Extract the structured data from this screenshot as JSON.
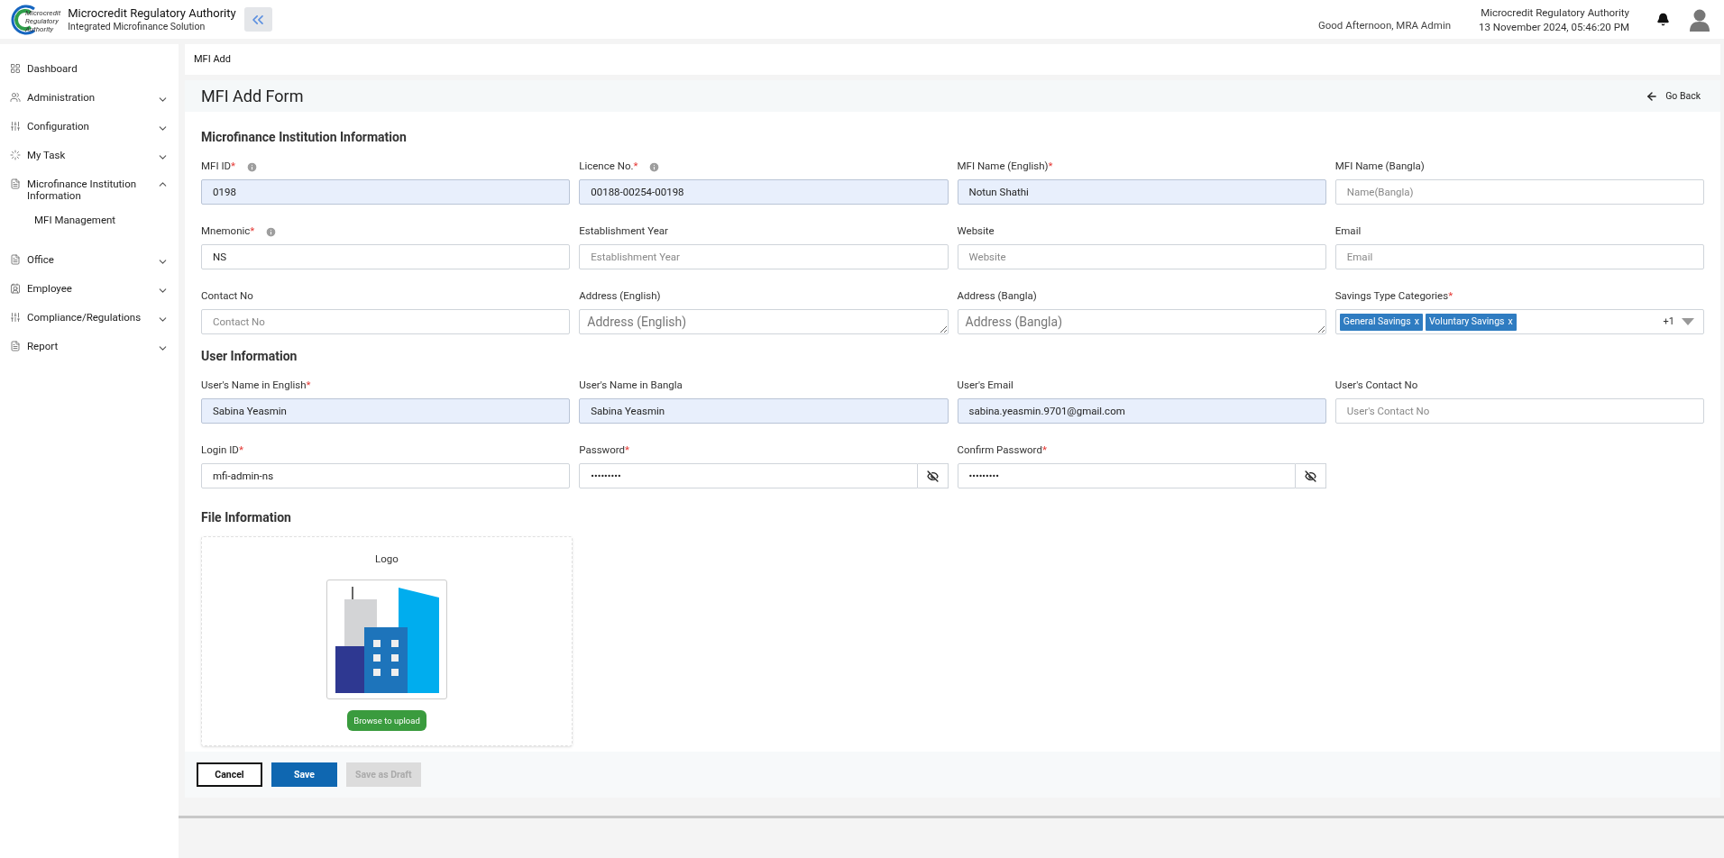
{
  "header": {
    "org_name": "Microcredit Regulatory Authority",
    "subtitle": "Integrated Microfinance Solution",
    "logo_text": [
      "Microcredit",
      "Regulatory",
      "Authority"
    ],
    "greeting": "Good Afternoon, MRA Admin",
    "org_right": "Microcredit Regulatory Authority",
    "datetime": "13 November 2024, 05:46:20 PM"
  },
  "sidebar": {
    "items": [
      {
        "label": "Dashboard"
      },
      {
        "label": "Administration",
        "expanded": false
      },
      {
        "label": "Configuration",
        "expanded": false
      },
      {
        "label": "My Task",
        "expanded": false
      },
      {
        "label": "Microfinance Institution Information",
        "expanded": true,
        "children": [
          {
            "label": "MFI Management"
          }
        ]
      },
      {
        "label": "Office",
        "expanded": false
      },
      {
        "label": "Employee",
        "expanded": false
      },
      {
        "label": "Compliance/Regulations",
        "expanded": false
      },
      {
        "label": "Report",
        "expanded": false
      }
    ]
  },
  "breadcrumb": "MFI Add",
  "page_title": "MFI Add Form",
  "go_back": "Go Back",
  "sections": [
    {
      "title": "Microfinance Institution Information",
      "fields": [
        {
          "kind": "input",
          "label": "MFI ID",
          "required_mark": "*",
          "info": true,
          "value": "0198",
          "disabled": true
        },
        {
          "kind": "input",
          "label": "Licence No.",
          "required_mark": "*",
          "info": true,
          "value": "00188-00254-00198",
          "disabled": true
        },
        {
          "kind": "input",
          "label": "MFI Name (English)",
          "required_mark": "*",
          "value": "Notun Shathi",
          "disabled": true
        },
        {
          "kind": "input",
          "label": "MFI Name (Bangla)",
          "placeholder": "Name(Bangla)",
          "disabled": false
        },
        {
          "kind": "input",
          "label": "Mnemonic",
          "required_mark": "*",
          "info": true,
          "value": "NS",
          "disabled": false
        },
        {
          "kind": "input",
          "label": "Establishment Year",
          "placeholder": "Establishment Year",
          "disabled": false
        },
        {
          "kind": "input",
          "label": "Website",
          "placeholder": "Website",
          "disabled": false
        },
        {
          "kind": "input",
          "label": "Email",
          "placeholder": "Email",
          "disabled": false
        },
        {
          "kind": "input",
          "label": "Contact No",
          "placeholder": "Contact No",
          "disabled": false
        },
        {
          "kind": "textarea",
          "label": "Address (English)",
          "placeholder": "Address (English)",
          "disabled": false
        },
        {
          "kind": "textarea",
          "label": "Address (Bangla)",
          "placeholder": "Address (Bangla)",
          "disabled": false
        },
        {
          "kind": "multiselect",
          "label": "Savings Type Categories",
          "required_mark": "*",
          "tags": [
            {
              "label": "General Savings",
              "remove": "x"
            },
            {
              "label": "Voluntary Savings",
              "remove": "x"
            }
          ],
          "more": "+1",
          "disabled": false
        }
      ]
    },
    {
      "title": "User Information",
      "fields": [
        {
          "kind": "input",
          "label": "User's Name in English",
          "required_mark": "*",
          "value": "Sabina Yeasmin",
          "disabled": true
        },
        {
          "kind": "input",
          "label": "User's Name in Bangla",
          "value": "Sabina Yeasmin",
          "disabled": true
        },
        {
          "kind": "input",
          "label": "User's Email",
          "value": "sabina.yeasmin.9701@gmail.com",
          "disabled": true
        },
        {
          "kind": "input",
          "label": "User's Contact No",
          "placeholder": "User's Contact No",
          "disabled": false
        },
        {
          "kind": "input",
          "label": "Login ID",
          "required_mark": "*",
          "value": "mfi-admin-ns",
          "disabled": false
        },
        {
          "kind": "password",
          "label": "Password",
          "required_mark": "*",
          "value": "•••••••••",
          "disabled": false
        },
        {
          "kind": "password",
          "label": "Confirm Password",
          "required_mark": "*",
          "value": "•••••••••",
          "disabled": false
        }
      ]
    }
  ],
  "file_section": {
    "title": "File Information",
    "card_title": "Logo",
    "upload_button": "Browse to upload"
  },
  "actions": [
    {
      "label": "Cancel",
      "kind": "outline",
      "disabled": false
    },
    {
      "label": "Save",
      "kind": "primary",
      "disabled": false
    },
    {
      "label": "Save as Draft",
      "kind": "secondary",
      "disabled": true
    }
  ]
}
